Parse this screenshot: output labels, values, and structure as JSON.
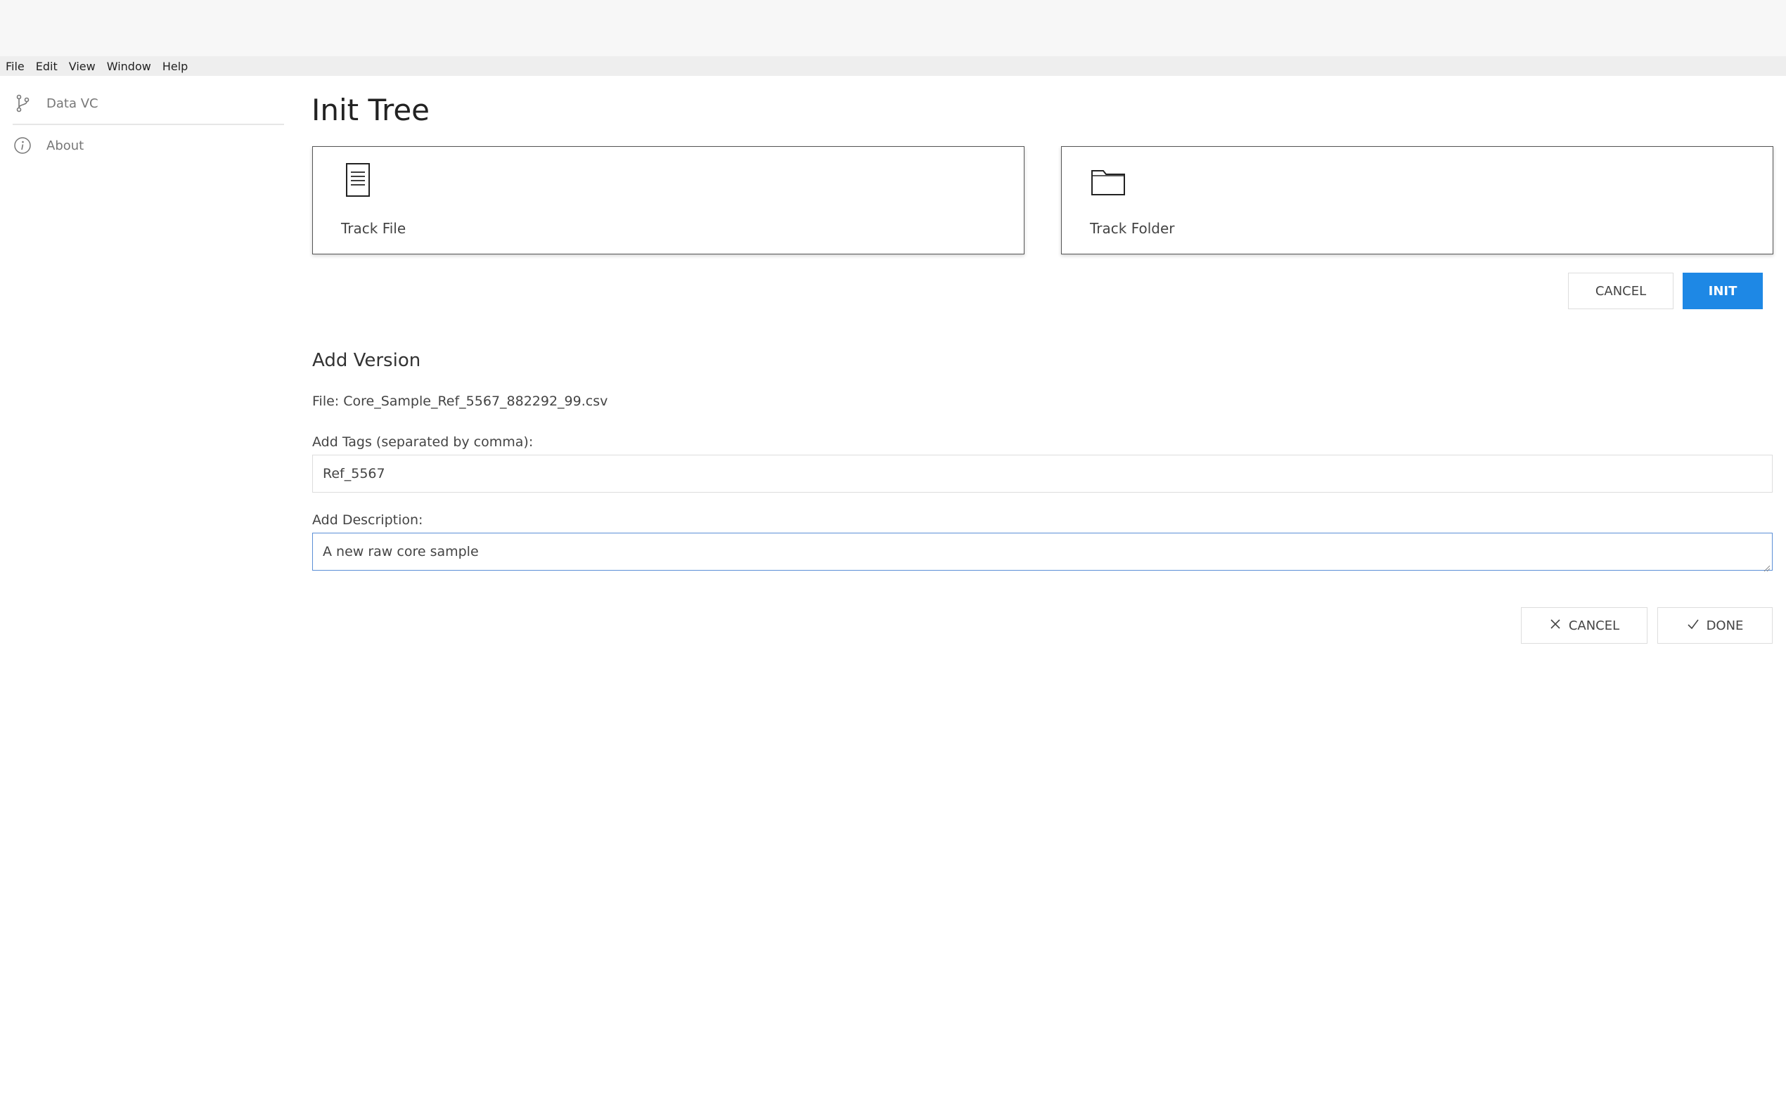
{
  "menubar": {
    "items": [
      "File",
      "Edit",
      "View",
      "Window",
      "Help"
    ]
  },
  "sidebar": {
    "items": [
      {
        "label": "Data VC",
        "icon": "branch-icon"
      },
      {
        "label": "About",
        "icon": "info-icon"
      }
    ]
  },
  "main": {
    "title": "Init Tree",
    "cards": [
      {
        "label": "Track File",
        "icon": "file-document-icon"
      },
      {
        "label": "Track Folder",
        "icon": "folder-icon"
      }
    ],
    "init_cancel_label": "CANCEL",
    "init_label": "INIT",
    "accent_color": "#1e88e5"
  },
  "add_version": {
    "title": "Add Version",
    "file_text": "File: Core_Sample_Ref_5567_882292_99.csv",
    "tags_label": "Add Tags (separated by comma):",
    "tags_value": "Ref_5567",
    "description_label": "Add Description:",
    "description_value": "A new raw core sample",
    "cancel_label": "CANCEL",
    "done_label": "DONE"
  }
}
